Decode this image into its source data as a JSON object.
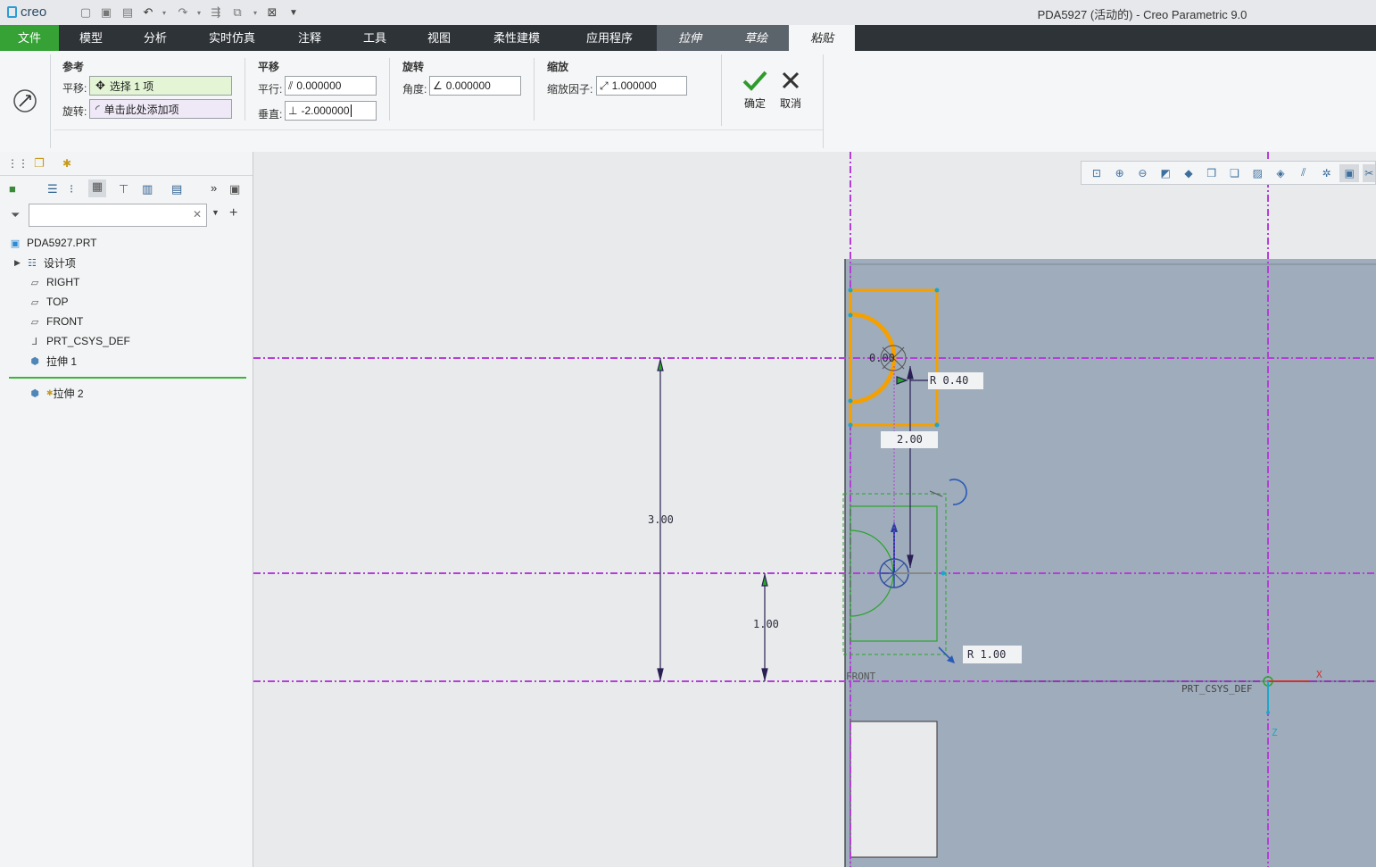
{
  "app": {
    "logo_text": "creo",
    "window_title": "PDA5927 (活动的) - Creo Parametric 9.0"
  },
  "tabs": [
    {
      "label": "文件"
    },
    {
      "label": "模型"
    },
    {
      "label": "分析"
    },
    {
      "label": "实时仿真"
    },
    {
      "label": "注释"
    },
    {
      "label": "工具"
    },
    {
      "label": "视图"
    },
    {
      "label": "柔性建模"
    },
    {
      "label": "应用程序"
    },
    {
      "label": "拉伸"
    },
    {
      "label": "草绘"
    },
    {
      "label": "粘贴"
    }
  ],
  "ribbon": {
    "reference": {
      "title": "参考",
      "translate_label": "平移:",
      "translate_value": "选择 1 项",
      "rotate_label": "旋转:",
      "rotate_value": "单击此处添加项"
    },
    "translation": {
      "title": "平移",
      "parallel_label": "平行:",
      "parallel_value": "0.000000",
      "perpendicular_label": "垂直:",
      "perpendicular_value": "-2.000000"
    },
    "rotation": {
      "title": "旋转",
      "angle_label": "角度:",
      "angle_value": "0.000000"
    },
    "scale": {
      "title": "缩放",
      "factor_label": "缩放因子:",
      "factor_value": "1.000000"
    },
    "ok_label": "确定",
    "cancel_label": "取消"
  },
  "model_tree": {
    "items": [
      {
        "label": "PDA5927.PRT",
        "icon": "part-icon"
      },
      {
        "label": "设计项",
        "icon": "design-items-icon"
      },
      {
        "label": "RIGHT",
        "icon": "datum-plane-icon"
      },
      {
        "label": "TOP",
        "icon": "datum-plane-icon"
      },
      {
        "label": "FRONT",
        "icon": "datum-plane-icon"
      },
      {
        "label": "PRT_CSYS_DEF",
        "icon": "csys-icon"
      },
      {
        "label": "拉伸 1",
        "icon": "extrude-icon"
      },
      {
        "label": "拉伸 2",
        "icon": "extrude-icon"
      }
    ]
  },
  "graphics": {
    "dims": {
      "d1": "0.00",
      "d2": "R 0.40",
      "d3": "2.00",
      "d4": "3.00",
      "d5": "1.00",
      "d6": "R 1.00"
    },
    "labels": {
      "front": "FRONT",
      "csys": "PRT_CSYS_DEF",
      "x_axis": "X",
      "z_axis": "Z"
    }
  },
  "colors": {
    "accent": "#36a236",
    "ribbon_dark": "#2e3338",
    "selected_orange": "#f5a000",
    "datum_magenta": "#b43fd6",
    "preview_green": "#2aa52a",
    "model_gray": "#9eacbb"
  }
}
